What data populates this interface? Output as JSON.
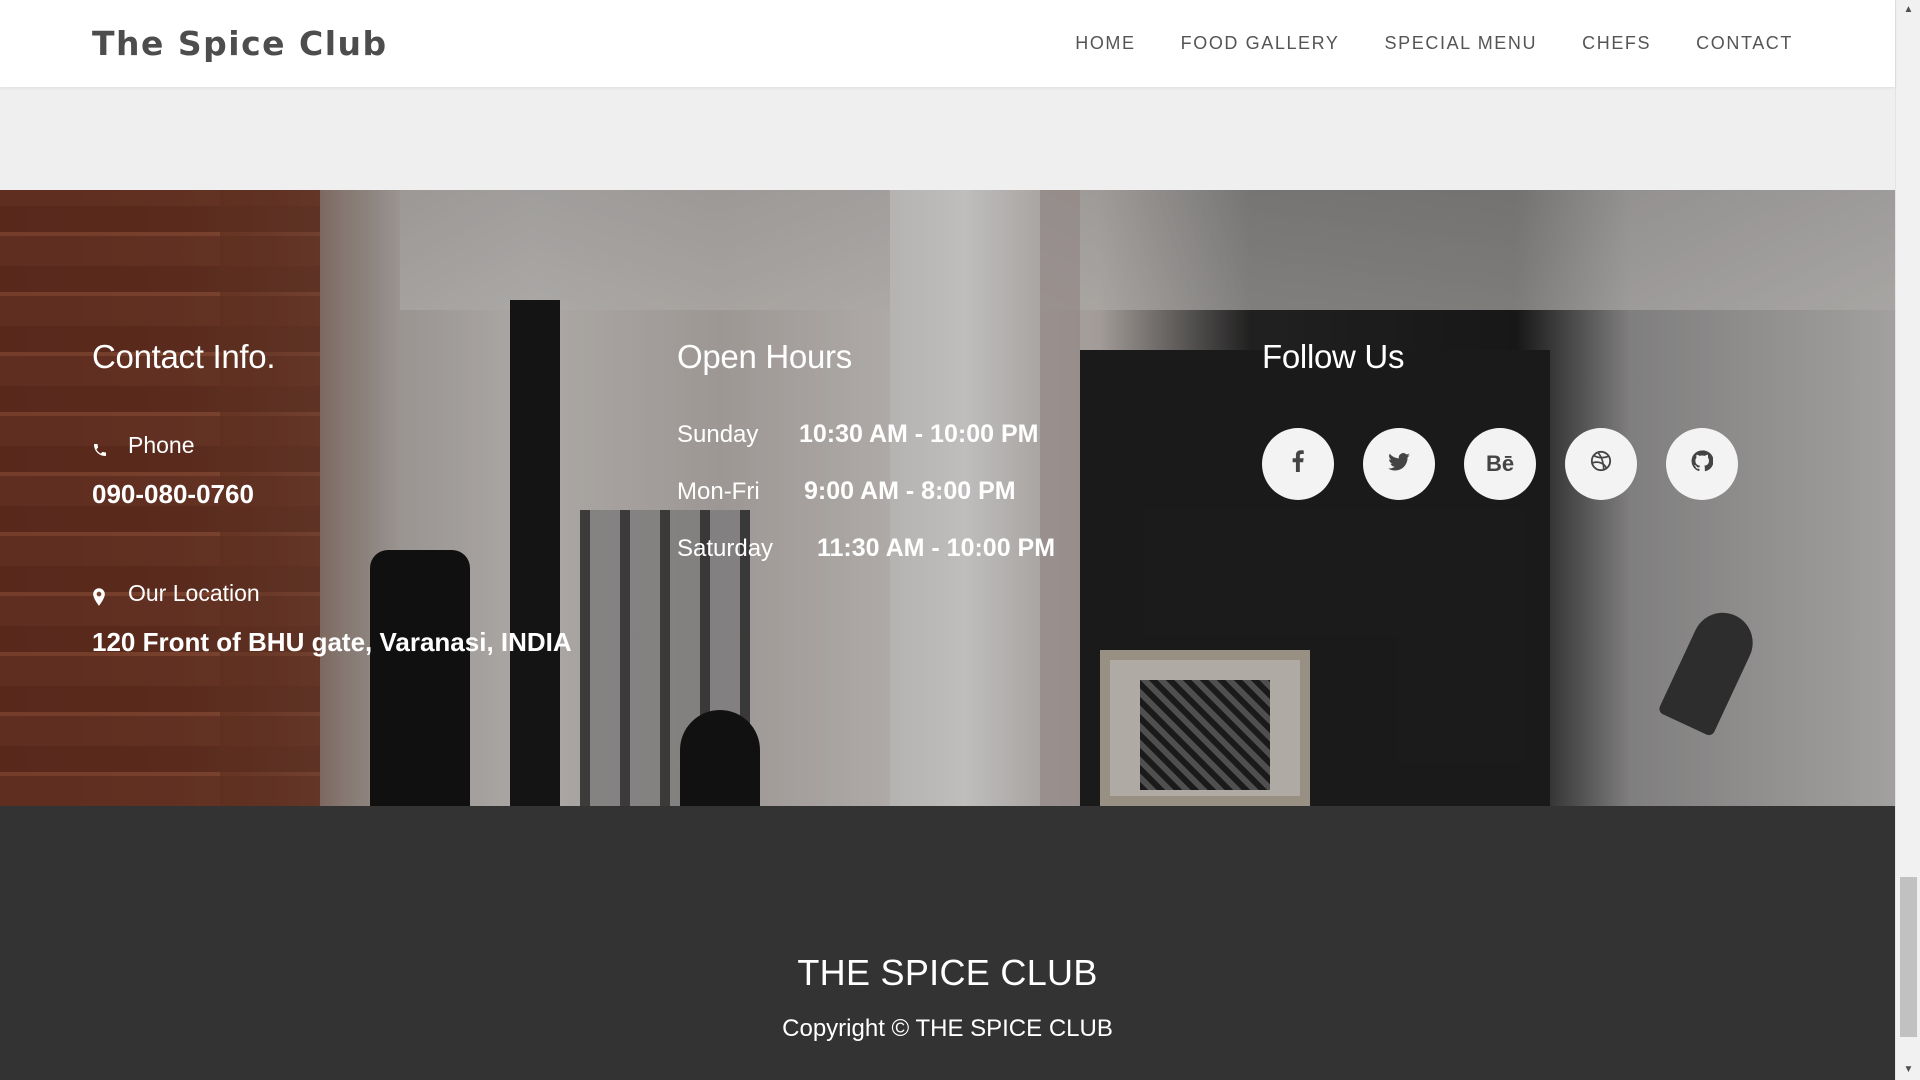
{
  "nav": {
    "brand": "The Spice Club",
    "links": [
      "HOME",
      "FOOD GALLERY",
      "SPECIAL MENU",
      "CHEFS",
      "CONTACT"
    ]
  },
  "contact": {
    "heading": "Contact Info.",
    "phone_label": "Phone",
    "phone_value": "090-080-0760",
    "location_label": "Our Location",
    "location_value": "120 Front of BHU gate, Varanasi, INDIA",
    "icons": [
      "phone-icon",
      "location-pin-icon"
    ]
  },
  "hours": {
    "heading": "Open Hours",
    "rows": [
      {
        "day": "Sunday",
        "time": "10:30 AM - 10:00 PM"
      },
      {
        "day": "Mon-Fri",
        "time": "9:00 AM - 8:00 PM"
      },
      {
        "day": "Saturday",
        "time": "11:30 AM - 10:00 PM"
      }
    ]
  },
  "follow": {
    "heading": "Follow Us",
    "socials": [
      {
        "icon": "facebook-icon",
        "glyph": "f"
      },
      {
        "icon": "twitter-icon",
        "glyph": "🐦"
      },
      {
        "icon": "behance-icon",
        "glyph": "Bē"
      },
      {
        "icon": "dribbble-icon",
        "glyph": "⊛"
      },
      {
        "icon": "github-icon",
        "glyph": "⌾"
      }
    ]
  },
  "footer": {
    "title": "THE SPICE CLUB",
    "copyright": "Copyright © THE SPICE CLUB"
  },
  "colors": {
    "nav_bg": "#ffffff",
    "page_bg": "#efefef",
    "footer_bg": "#333333",
    "social_bg": "#f3f3f3",
    "text_dark": "#4d4d4d"
  }
}
